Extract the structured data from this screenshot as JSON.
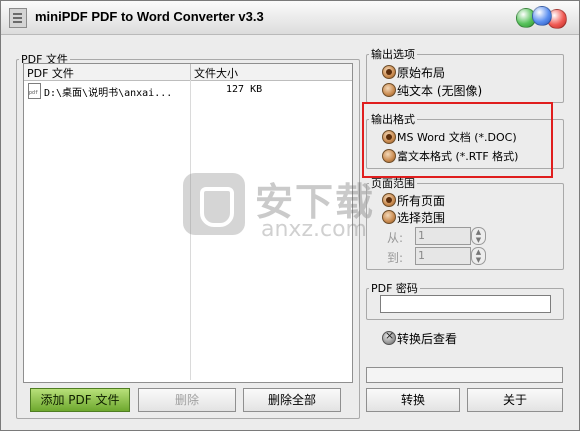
{
  "window": {
    "title": "miniPDF PDF to Word Converter v3.3"
  },
  "file_panel": {
    "legend": "PDF 文件",
    "columns": [
      "PDF 文件",
      "文件大小"
    ],
    "rows": [
      {
        "name": "D:\\桌面\\说明书\\anxai...",
        "size": "127 KB"
      }
    ],
    "buttons": {
      "add": "添加 PDF 文件",
      "delete": "删除",
      "delete_all": "删除全部"
    }
  },
  "output_options": {
    "legend": "输出选项",
    "items": [
      "原始布局",
      "纯文本 (无图像)"
    ]
  },
  "output_format": {
    "legend": "输出格式",
    "items": [
      "MS Word 文档 (*.DOC)",
      "富文本格式 (*.RTF 格式)"
    ]
  },
  "page_range": {
    "legend": "页面范围",
    "items": [
      "所有页面",
      "选择范围"
    ],
    "from_label": "从:",
    "from_value": "1",
    "to_label": "到:",
    "to_value": "1"
  },
  "password": {
    "legend": "PDF 密码",
    "value": ""
  },
  "view_after": {
    "label": "转换后查看"
  },
  "actions": {
    "convert": "转换",
    "about": "关于"
  },
  "watermark": {
    "text": "安下载",
    "sub": "anxz.com"
  },
  "colors": {
    "highlight": "#e01e1e",
    "add_button": "#6ea82e"
  }
}
